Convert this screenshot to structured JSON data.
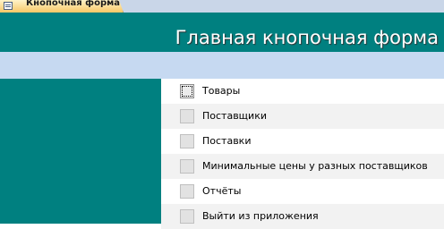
{
  "tab": {
    "label": "Кнопочная форма",
    "icon": "form-icon"
  },
  "header": {
    "title": "Главная кнопочная форма"
  },
  "colors": {
    "header": "#008080",
    "subbar": "#c6d9f1",
    "tab": "#f7c766"
  },
  "menu": {
    "items": [
      {
        "label": "Товары"
      },
      {
        "label": "Поставщики"
      },
      {
        "label": "Поставки"
      },
      {
        "label": "Минимальные цены у разных поставщиков"
      },
      {
        "label": "Отчёты"
      },
      {
        "label": "Выйти из приложения"
      }
    ]
  }
}
